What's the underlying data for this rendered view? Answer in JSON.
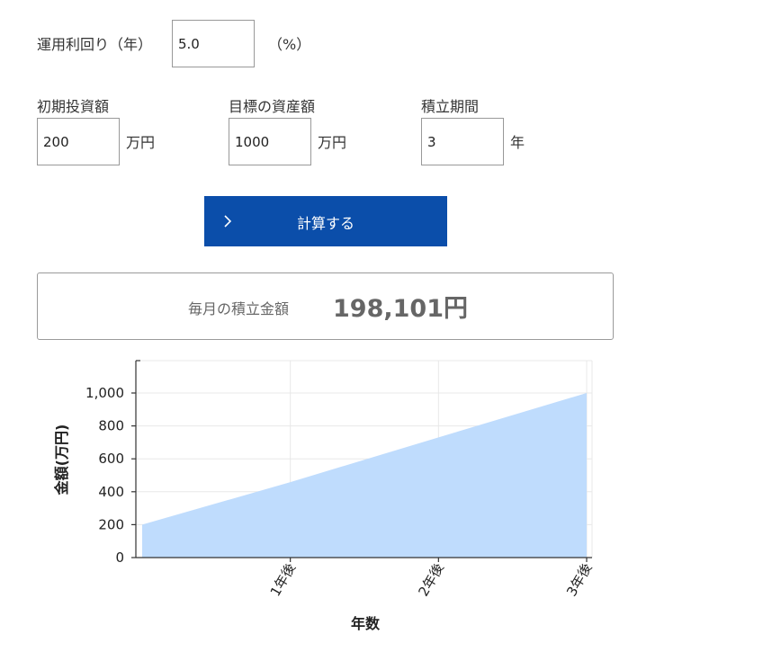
{
  "form": {
    "rate": {
      "label": "運用利回り（年）",
      "value": "5.0",
      "unit": "（%）"
    },
    "initial": {
      "label": "初期投資額",
      "value": "200",
      "unit": "万円"
    },
    "target": {
      "label": "目標の資産額",
      "value": "1000",
      "unit": "万円"
    },
    "period": {
      "label": "積立期間",
      "value": "3",
      "unit": "年"
    }
  },
  "button": {
    "label": "計算する",
    "icon": "chevron-right-icon"
  },
  "result": {
    "label": "毎月の積立金額",
    "value": "198,101円"
  },
  "chart_data": {
    "type": "area",
    "x": [
      0,
      1,
      2,
      3
    ],
    "tick_labels": [
      "1年後",
      "2年後",
      "3年後"
    ],
    "values": [
      200,
      458.5,
      730.2,
      1000
    ],
    "xlabel": "年数",
    "ylabel": "金額(万円)",
    "ylim": [
      0,
      1200
    ],
    "yticks": [
      0,
      200,
      400,
      600,
      800,
      1000
    ],
    "ytick_labels": [
      "0",
      "200",
      "400",
      "600",
      "800",
      "1,000"
    ],
    "grid": true,
    "fill_color": "#bfdcfd"
  }
}
